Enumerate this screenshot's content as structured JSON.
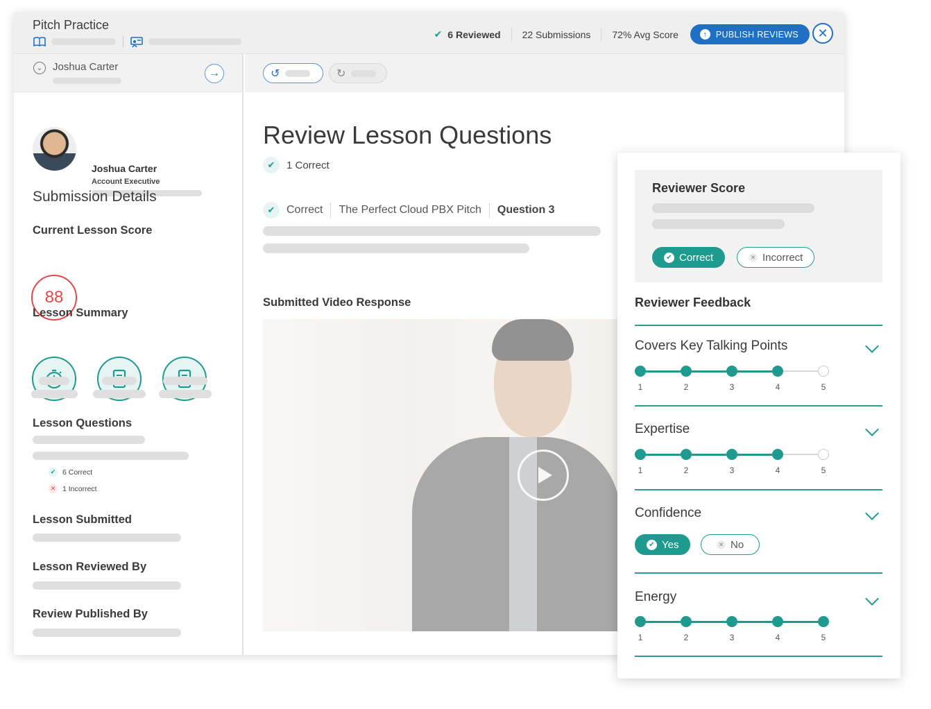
{
  "app": {
    "title": "Pitch Practice",
    "accent": "#1f9a8f",
    "brand_blue": "#1f6fc4",
    "alert_red": "#e24a4a"
  },
  "header": {
    "reviewed": "6 Reviewed",
    "submissions": "22 Submissions",
    "avg_score": "72% Avg Score",
    "publish_label": "PUBLISH REVIEWS",
    "crumb_icons": [
      "book-icon",
      "presentation-icon"
    ]
  },
  "sidebar": {
    "learner_select": "Joshua Carter",
    "profile": {
      "name": "Joshua Carter",
      "role": "Account Executive"
    },
    "submission_heading": "Submission Details",
    "score_heading": "Current Lesson Score",
    "score_value": "88",
    "summary_heading": "Lesson Summary",
    "summary_icons": [
      "stopwatch-icon",
      "document-icon",
      "document-icon"
    ],
    "questions_heading": "Lesson Questions",
    "correct_count": "6 Correct",
    "incorrect_count": "1 Incorrect",
    "submitted_heading": "Lesson Submitted",
    "reviewed_by_heading": "Lesson Reviewed By",
    "published_by_heading": "Review Published By"
  },
  "main": {
    "title": "Review Lesson Questions",
    "correct_summary": "1 Correct",
    "question": {
      "status": "Correct",
      "lesson": "The Perfect Cloud PBX Pitch",
      "number": "Question 3"
    },
    "video_heading": "Submitted Video Response"
  },
  "review": {
    "score_title": "Reviewer Score",
    "correct_label": "Correct",
    "incorrect_label": "Incorrect",
    "selected": "Correct",
    "feedback_title": "Reviewer Feedback",
    "criteria": [
      {
        "label": "Covers Key Talking Points",
        "rating": 4,
        "max": 5
      },
      {
        "label": "Expertise",
        "rating": 4,
        "max": 5
      },
      {
        "label": "Confidence",
        "yes_label": "Yes",
        "no_label": "No",
        "selected": "Yes"
      },
      {
        "label": "Energy",
        "rating": 5,
        "max": 5
      }
    ]
  }
}
